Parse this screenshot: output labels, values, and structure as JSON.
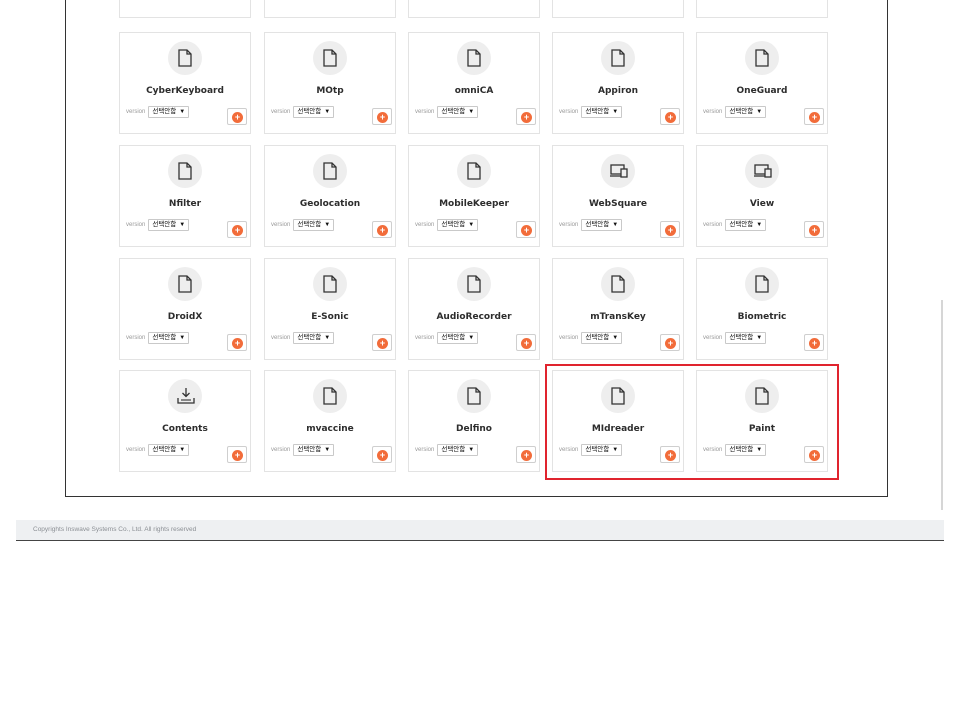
{
  "version_label": "version",
  "select_value": "선택안함",
  "add_symbol": "+",
  "footer": {
    "copyright": "Copyrights Inswave Systems Co., Ltd. All rights reserved"
  },
  "rows": [
    [
      {
        "name": "CyberKeyboard",
        "icon": "document-icon"
      },
      {
        "name": "MOtp",
        "icon": "document-icon"
      },
      {
        "name": "omniCA",
        "icon": "document-icon"
      },
      {
        "name": "Appiron",
        "icon": "document-icon"
      },
      {
        "name": "OneGuard",
        "icon": "document-icon"
      }
    ],
    [
      {
        "name": "Nfilter",
        "icon": "document-icon"
      },
      {
        "name": "Geolocation",
        "icon": "document-icon"
      },
      {
        "name": "MobileKeeper",
        "icon": "document-icon"
      },
      {
        "name": "WebSquare",
        "icon": "devices-icon"
      },
      {
        "name": "View",
        "icon": "devices-icon"
      }
    ],
    [
      {
        "name": "DroidX",
        "icon": "document-icon"
      },
      {
        "name": "E-Sonic",
        "icon": "document-icon"
      },
      {
        "name": "AudioRecorder",
        "icon": "document-icon"
      },
      {
        "name": "mTransKey",
        "icon": "document-icon"
      },
      {
        "name": "Biometric",
        "icon": "document-icon"
      }
    ],
    [
      {
        "name": "Contents",
        "icon": "download-tray-icon"
      },
      {
        "name": "mvaccine",
        "icon": "document-icon"
      },
      {
        "name": "Delfino",
        "icon": "document-icon"
      },
      {
        "name": "MIdreader",
        "icon": "document-icon"
      },
      {
        "name": "Paint",
        "icon": "document-icon"
      }
    ]
  ],
  "colors": {
    "accent": "#f26c3a",
    "highlight": "#e0242e"
  }
}
